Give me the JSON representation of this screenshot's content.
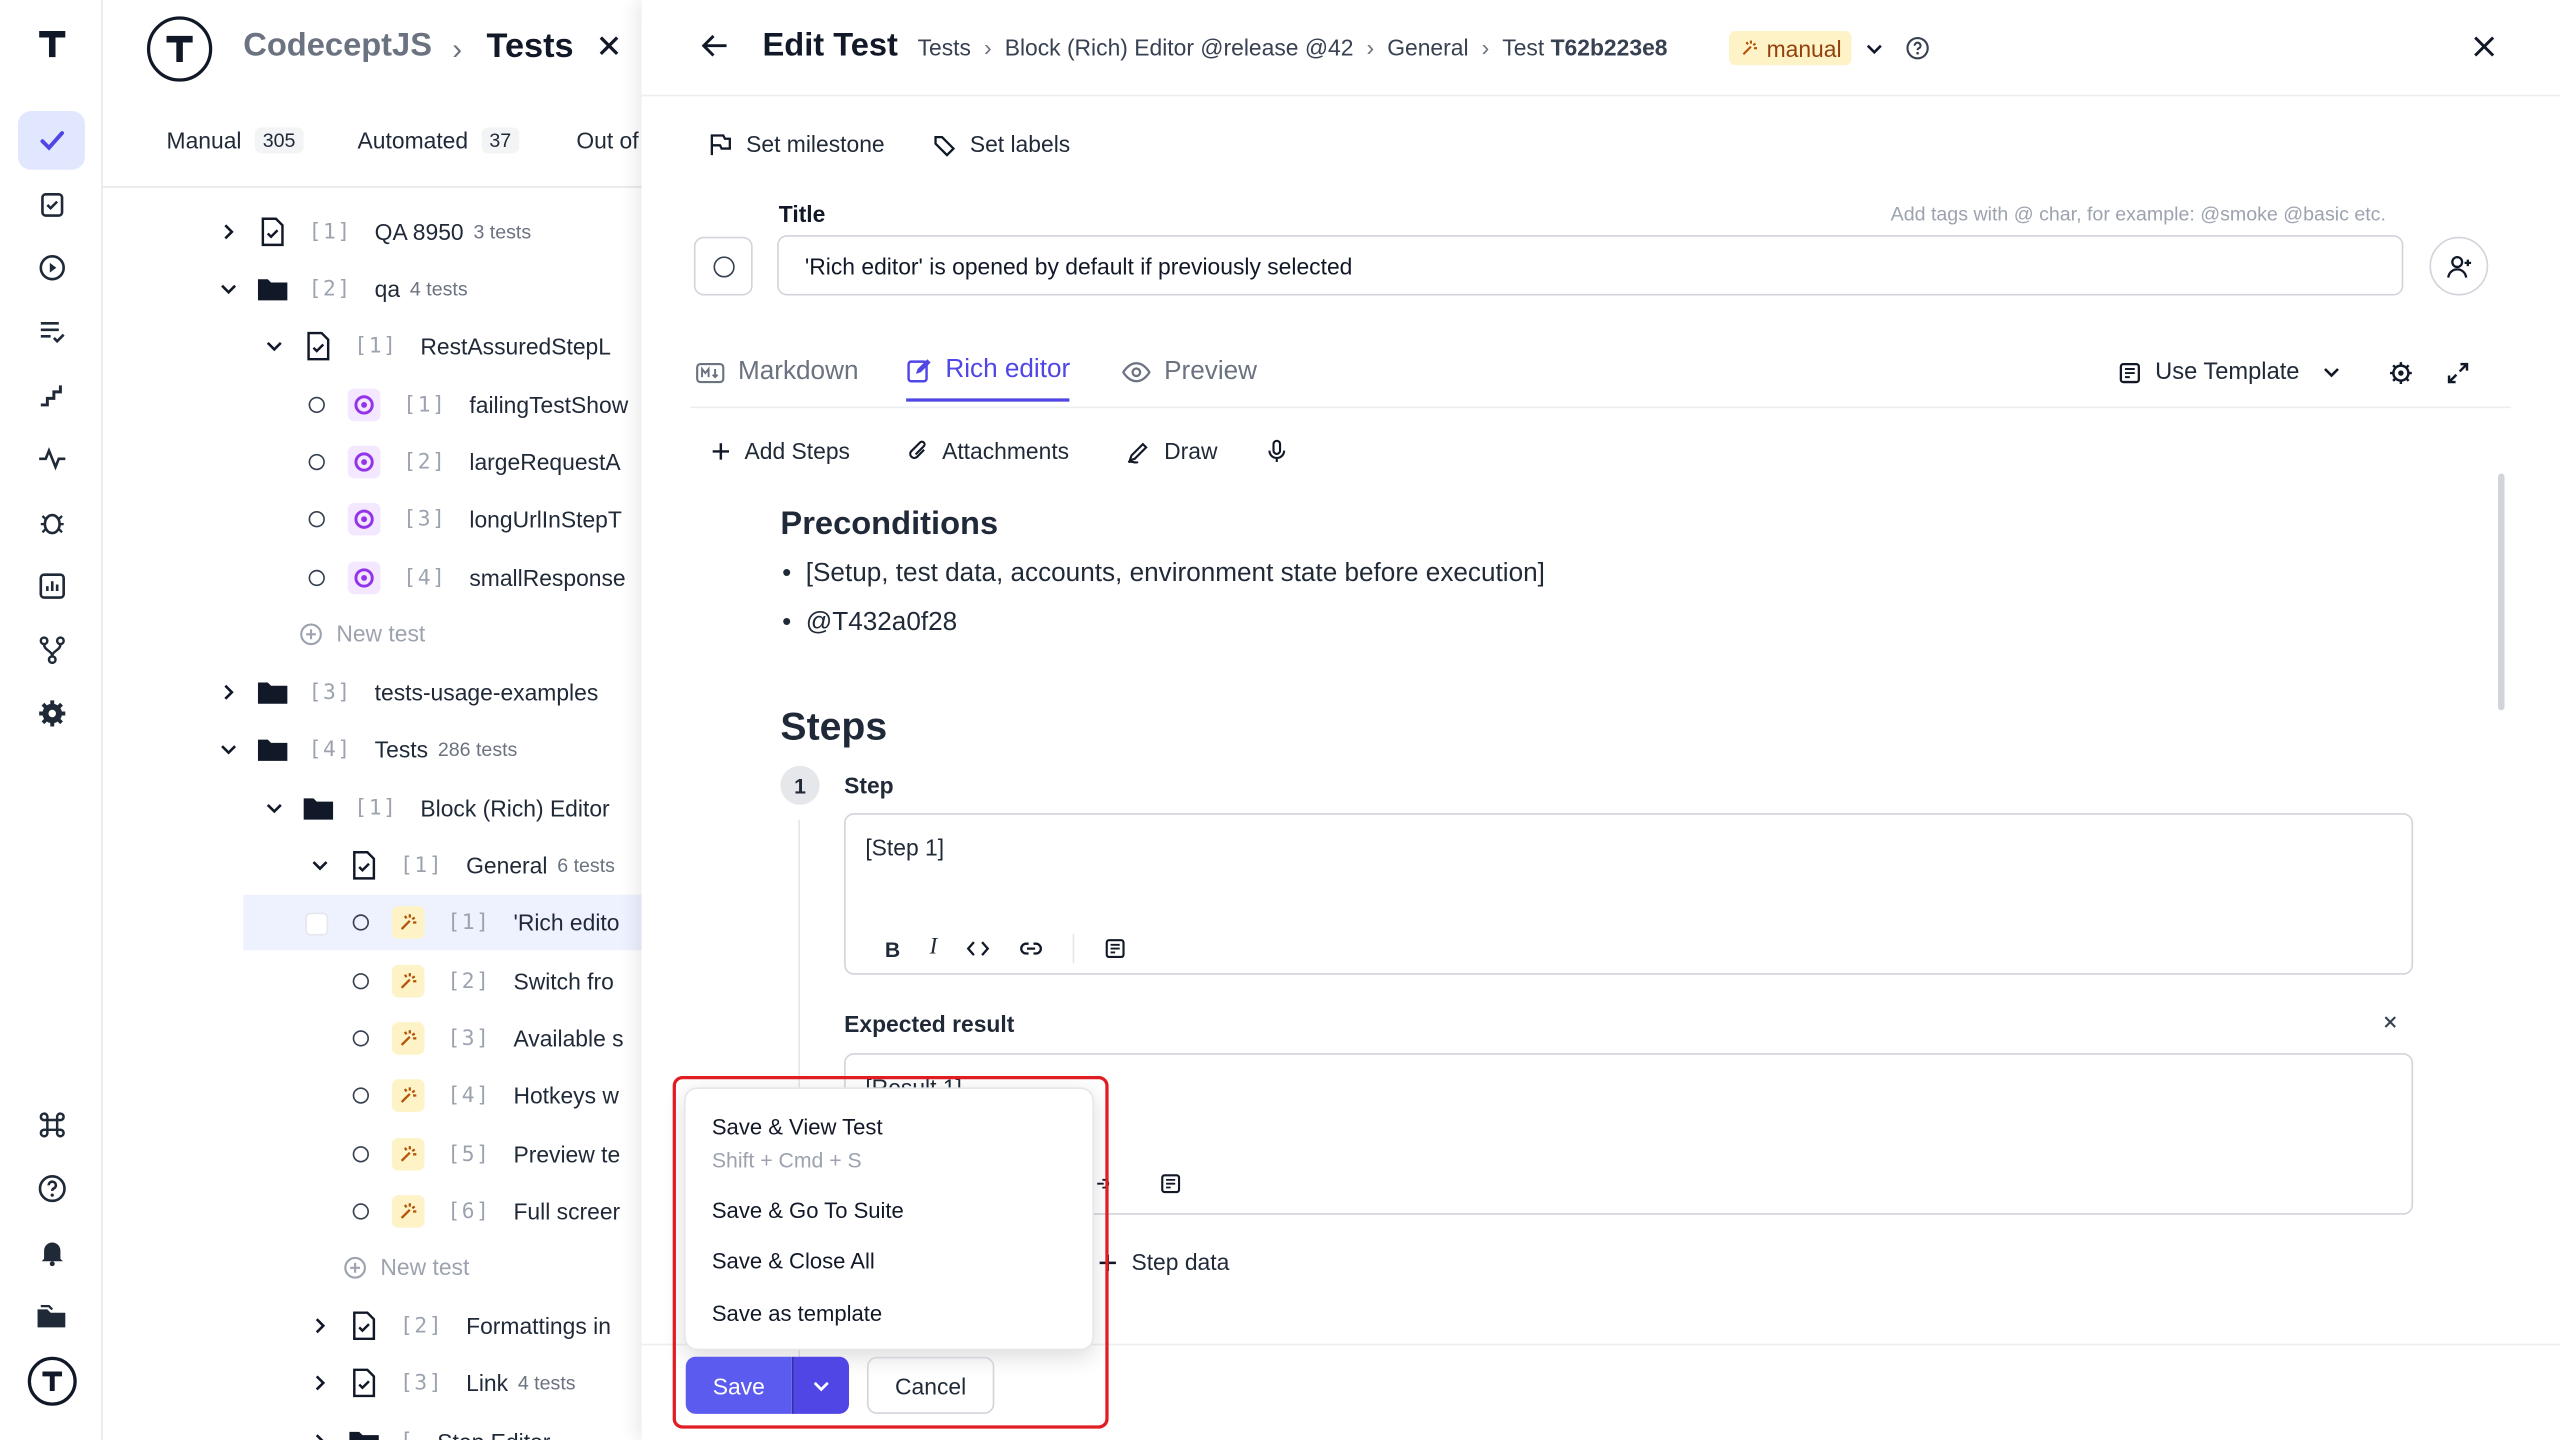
{
  "app": {
    "name": "CodeceptJS",
    "section": "Tests"
  },
  "filters": [
    {
      "label": "Manual",
      "count": "305"
    },
    {
      "label": "Automated",
      "count": "37"
    },
    {
      "label": "Out of",
      "count": ""
    }
  ],
  "tree": {
    "rows": [
      {
        "idx": "[1]",
        "label": "QA 8950",
        "count": "3 tests"
      },
      {
        "idx": "[2]",
        "label": "qa",
        "count": "4 tests"
      },
      {
        "idx": "[1]",
        "label": "RestAssuredStepL",
        "count": ""
      },
      {
        "idx": "[1]",
        "label": "failingTestShow",
        "count": ""
      },
      {
        "idx": "[2]",
        "label": "largeRequestA",
        "count": ""
      },
      {
        "idx": "[3]",
        "label": "longUrlInStepT",
        "count": ""
      },
      {
        "idx": "[4]",
        "label": "smallResponse",
        "count": ""
      },
      {
        "idx": "[3]",
        "label": "tests-usage-examples",
        "count": ""
      },
      {
        "idx": "[4]",
        "label": "Tests",
        "count": "286 tests"
      },
      {
        "idx": "[1]",
        "label": "Block (Rich) Editor",
        "count": ""
      },
      {
        "idx": "[1]",
        "label": "General",
        "count": "6 tests"
      },
      {
        "idx": "[1]",
        "label": "'Rich edito",
        "count": ""
      },
      {
        "idx": "[2]",
        "label": "Switch fro",
        "count": ""
      },
      {
        "idx": "[3]",
        "label": "Available s",
        "count": ""
      },
      {
        "idx": "[4]",
        "label": "Hotkeys w",
        "count": ""
      },
      {
        "idx": "[5]",
        "label": "Preview te",
        "count": ""
      },
      {
        "idx": "[6]",
        "label": "Full screer",
        "count": ""
      },
      {
        "idx": "[2]",
        "label": "Formattings in",
        "count": ""
      },
      {
        "idx": "[3]",
        "label": "Link",
        "count": "4 tests"
      },
      {
        "idx": "[",
        "label": "Step Editor",
        "count": ""
      }
    ],
    "new_test": "New test"
  },
  "editor": {
    "heading": "Edit Test",
    "breadcrumb": [
      "Tests",
      "Block (Rich) Editor @release @42",
      "General"
    ],
    "test_prefix": "Test",
    "test_id": "T62b223e8",
    "status": "manual",
    "set_milestone": "Set milestone",
    "set_labels": "Set labels",
    "title_label": "Title",
    "title_hint": "Add tags with @ char, for example: @smoke @basic etc.",
    "title_value": "'Rich editor' is opened by default if previously selected",
    "tabs": [
      "Markdown",
      "Rich editor",
      "Preview"
    ],
    "use_template": "Use Template",
    "toolbar": {
      "add_steps": "Add Steps",
      "attachments": "Attachments",
      "draw": "Draw"
    },
    "preconditions_heading": "Preconditions",
    "preconditions": [
      "[Setup, test data, accounts, environment state before execution]",
      "@T432a0f28"
    ],
    "steps_heading": "Steps",
    "step_number": "1",
    "step_label": "Step",
    "step_text": "[Step 1]",
    "expected_label": "Expected result",
    "expected_text": "[Result 1]",
    "step_data": "Step data",
    "save_menu": {
      "items": [
        "Save & View Test",
        "Save & Go To Suite",
        "Save & Close All",
        "Save as template"
      ],
      "shortcut": "Shift + Cmd + S"
    },
    "save": "Save",
    "cancel": "Cancel"
  },
  "colors": {
    "accent": "#4f46e5",
    "highlight": "#e11d24",
    "manual_badge": "#fef3c7"
  }
}
